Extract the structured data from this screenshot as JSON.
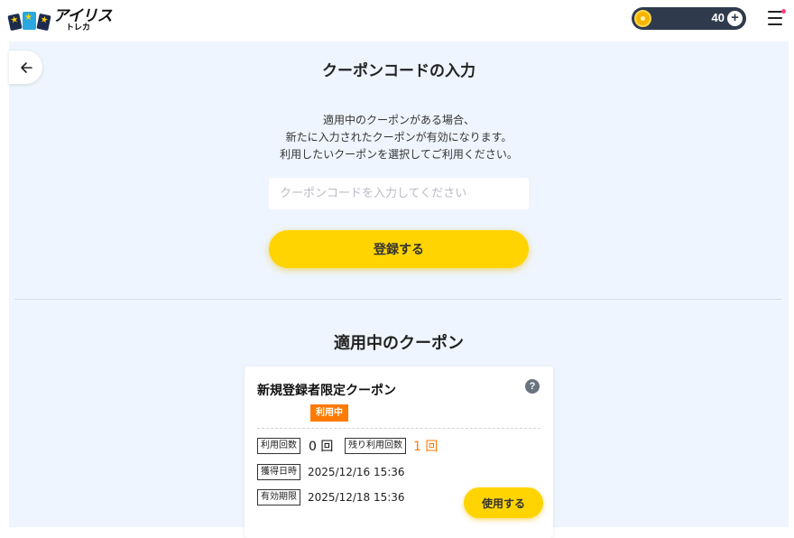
{
  "header": {
    "logo_main": "アイリス",
    "logo_sub": "トレカ",
    "coin_count": "40",
    "coin_plus": "+"
  },
  "code_section": {
    "title": "クーポンコードの入力",
    "desc_line1": "適用中のクーポンがある場合、",
    "desc_line2": "新たに入力されたクーポンが有効になります。",
    "desc_line3": "利用したいクーポンを選択してご利用ください。",
    "input_placeholder": "クーポンコードを入力してください",
    "input_value": "",
    "register_label": "登録する"
  },
  "active_section": {
    "title": "適用中のクーポン"
  },
  "coupon": {
    "name": "新規登録者限定クーポン",
    "help": "?",
    "status": "利用中",
    "used_label": "利用回数",
    "used_value": "0 回",
    "remaining_label": "残り利用回数",
    "remaining_value": "1 回",
    "acquired_label": "獲得日時",
    "acquired_value": "2025/12/16 15:36",
    "expiry_label": "有効期限",
    "expiry_value": "2025/12/18 15:36",
    "use_label": "使用する"
  },
  "colors": {
    "accent_yellow": "#ffd400",
    "badge_orange": "#ff7a00",
    "panel_bg": "#eef5fe",
    "coin_pill": "#2f3b4d"
  },
  "icons": {
    "logo": "cards-logo-icon",
    "coin": "coin-icon",
    "menu": "hamburger-menu-icon",
    "back": "arrow-left-icon",
    "help": "question-circle-icon"
  }
}
